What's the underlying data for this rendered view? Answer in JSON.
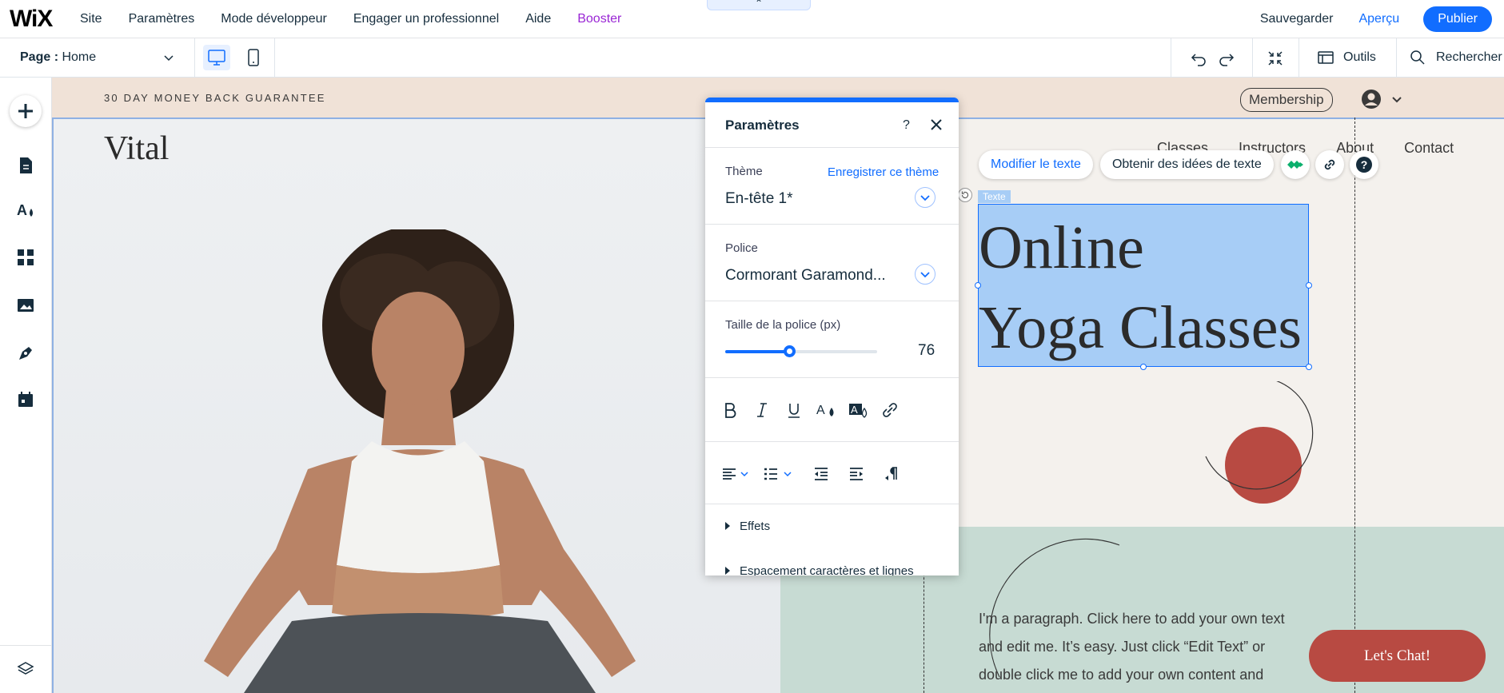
{
  "brand": {
    "logo": "WiX"
  },
  "topmenu": {
    "items": [
      "Site",
      "Paramètres",
      "Mode développeur",
      "Engager un professionnel",
      "Aide",
      "Booster"
    ],
    "collapse_glyph": "⌃",
    "save": "Sauvegarder",
    "preview": "Aperçu",
    "publish": "Publier"
  },
  "secondbar": {
    "page_label": "Page :",
    "page_name": "Home",
    "tools": "Outils",
    "search": "Rechercher"
  },
  "site": {
    "banner": "30 DAY MONEY BACK GUARANTEE",
    "membership": "Membership",
    "logo": "Vital",
    "nav": [
      "Classes",
      "Instructors",
      "About",
      "Contact"
    ],
    "hero_title": "Online\nYoga Classes",
    "text_tag": "Texte",
    "paragraph": "I'm a paragraph. Click here to add your own text and edit me. It’s easy. Just click “Edit Text” or double click me to add your own content and",
    "chat": "Let's Chat!"
  },
  "floating_toolbar": {
    "edit_text": "Modifier le texte",
    "get_ideas": "Obtenir des idées de texte"
  },
  "panel": {
    "title": "Paramètres",
    "help": "?",
    "theme_label": "Thème",
    "save_theme": "Enregistrer ce thème",
    "theme_value": "En-tête 1*",
    "font_label": "Police",
    "font_value": "Cormorant Garamond...",
    "size_label": "Taille de la police (px)",
    "size_value": "76",
    "size_fraction": 0.42,
    "effects": "Effets",
    "spacing": "Espacement caractères et lignes"
  },
  "colors": {
    "accent": "#116dff",
    "booster": "#9a27d5",
    "banner": "#f0e2d7",
    "sage": "#c7dbd3",
    "terracotta": "#b84a42",
    "selection": "#a7cdf6"
  }
}
